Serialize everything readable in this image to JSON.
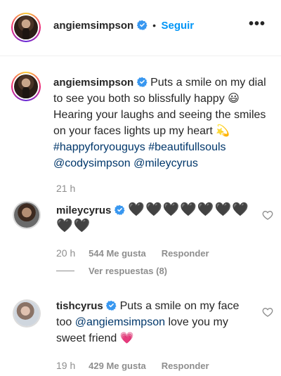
{
  "header": {
    "username": "angiemsimpson",
    "separator": "•",
    "follow_label": "Seguir",
    "more_label": "•••"
  },
  "caption": {
    "username": "angiemsimpson",
    "text_1": "Puts a smile on my dial to see you both so blissfully happy",
    "emoji_1": "😃",
    "text_2": "Hearing your laughs and seeing the smiles on your faces lights up my heart",
    "emoji_2": "💫",
    "hashtag_1": "#happyforyouguys",
    "hashtag_2": "#beautifullsouls",
    "mention_1": "@codysimpson",
    "mention_2": "@mileycyrus",
    "time": "21 h"
  },
  "comments": [
    {
      "username": "mileycyrus",
      "hearts_line_1": "🖤🖤🖤🖤🖤🖤🖤",
      "hearts_line_2": "🖤🖤",
      "time": "20 h",
      "likes": "544 Me gusta",
      "reply": "Responder",
      "view_replies": "Ver respuestas (8)"
    },
    {
      "username": "tishcyrus",
      "text_1": "Puts a smile on my face too",
      "mention": "@angiemsimpson",
      "text_2": "love you my sweet friend",
      "emoji": "💗",
      "time": "19 h",
      "likes": "429 Me gusta",
      "reply": "Responder"
    }
  ],
  "colors": {
    "link_blue": "#0095f6",
    "verified_blue": "#3897f0",
    "hashtag": "#00376b",
    "muted": "#8e8e8e"
  }
}
